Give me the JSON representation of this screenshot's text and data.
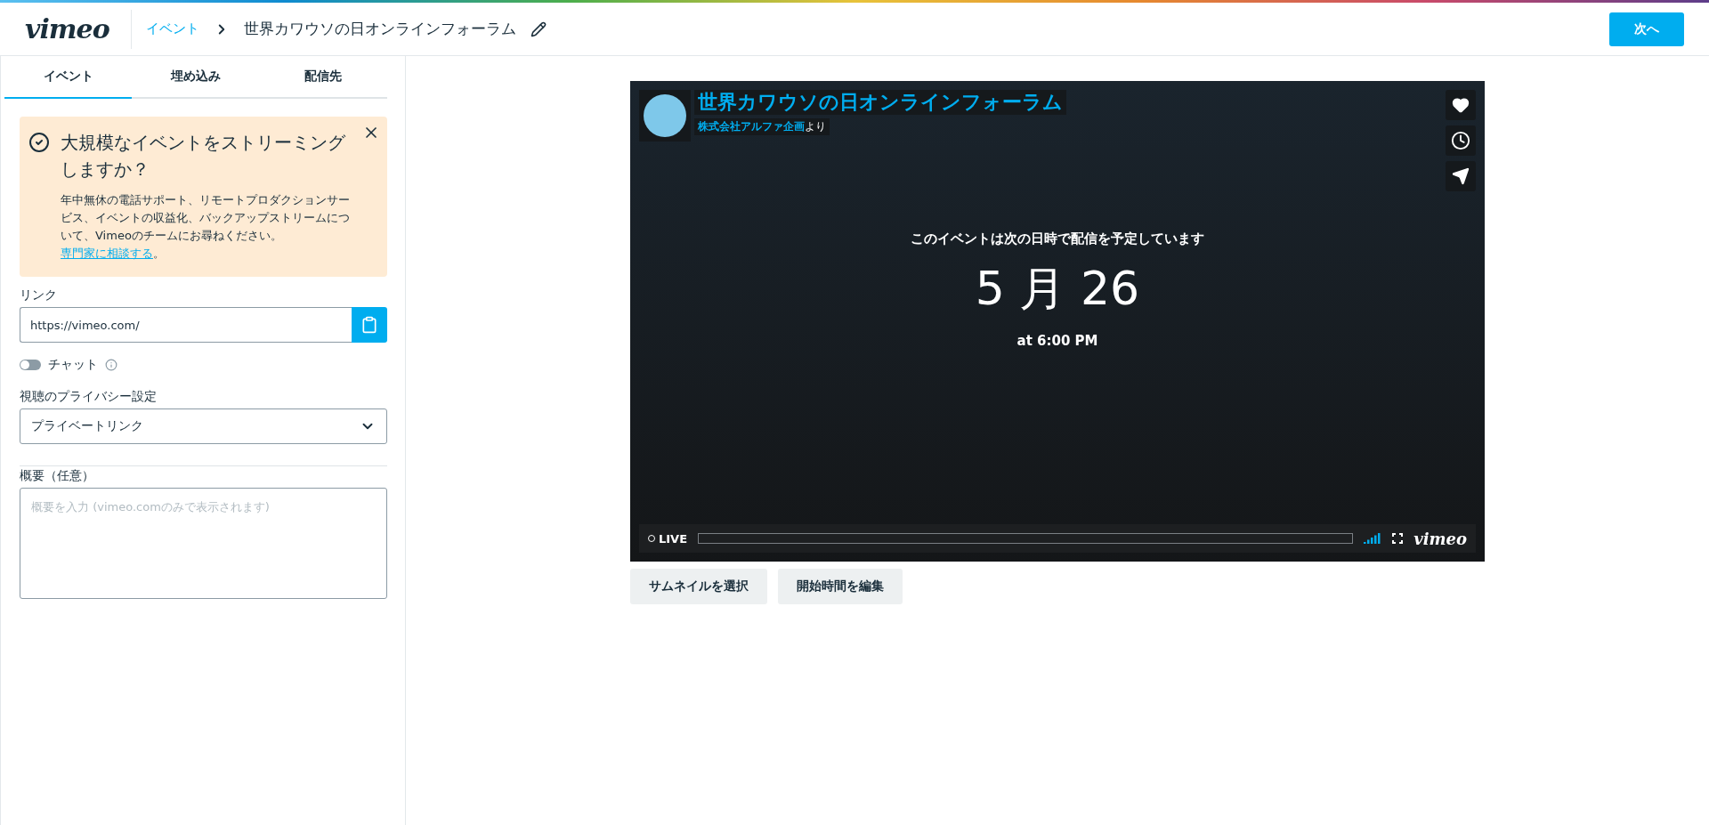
{
  "header": {
    "logo": "vimeo",
    "breadcrumb": "イベント",
    "title": "世界カワウソの日オンラインフォーラム",
    "next_button": "次へ"
  },
  "tabs": [
    {
      "label": "イベント",
      "selected": true
    },
    {
      "label": "埋め込み",
      "selected": false
    },
    {
      "label": "配信先",
      "selected": false
    }
  ],
  "promo": {
    "title": "大規模なイベントをストリーミングしますか？",
    "body": "年中無休の電話サポート、リモートプロダクションサービス、イベントの収益化、バックアップストリームについて、Vimeoのチームにお尋ねください。",
    "link": "専門家に相談する",
    "link_suffix": "。"
  },
  "link_field": {
    "label": "リンク",
    "value": "https://vimeo.com/"
  },
  "chat": {
    "label": "チャット",
    "on": false
  },
  "privacy": {
    "label": "視聴のプライバシー設定",
    "value": "プライベートリンク"
  },
  "description": {
    "label": "概要（任意）",
    "placeholder": "概要を入力 (vimeo.comのみで表示されます)"
  },
  "player": {
    "title": "世界カワウソの日オンラインフォーラム",
    "owner": "株式会社アルファ企画",
    "byline_suffix": "より",
    "notice": "このイベントは次の日時で配信を予定しています",
    "date": "5 月 26",
    "time": "at 6:00 PM",
    "live": "LIVE",
    "logo": "vimeo"
  },
  "actions": [
    "サムネイルを選択",
    "開始時間を編集"
  ]
}
